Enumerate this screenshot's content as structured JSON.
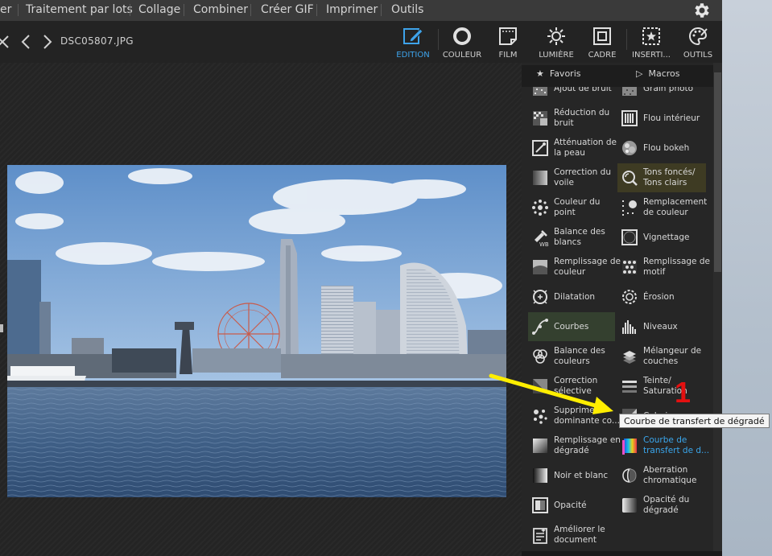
{
  "menu": {
    "items": [
      "er",
      "Traitement par lots",
      "Collage",
      "Combiner",
      "Créer GIF",
      "Imprimer",
      "Outils"
    ]
  },
  "toolbar": {
    "filename": "DSC05807.JPG",
    "tools": [
      {
        "label": "EDITION",
        "icon": "edit-icon",
        "active": true
      },
      {
        "label": "COULEUR",
        "icon": "color-ring-icon"
      },
      {
        "label": "FILM",
        "icon": "film-icon"
      },
      {
        "label": "LUMIÈRE",
        "icon": "sun-icon"
      },
      {
        "label": "CADRE",
        "icon": "frame-icon"
      },
      {
        "label": "INSERTI...",
        "icon": "insert-star-icon"
      },
      {
        "label": "OUTILS",
        "icon": "palette-tools-icon"
      }
    ]
  },
  "panel": {
    "favorites_label": "Favoris",
    "macros_label": "Macros",
    "effects": [
      {
        "label": "Ajout de bruit",
        "icon": "noise-add-icon"
      },
      {
        "label": "Grain photo",
        "icon": "grain-icon"
      },
      {
        "label": "Réduction du\nbruit",
        "icon": "noise-reduce-icon"
      },
      {
        "label": "Flou intérieur",
        "icon": "inner-blur-icon"
      },
      {
        "label": "Atténuation de\nla peau",
        "icon": "skin-soften-icon"
      },
      {
        "label": "Flou bokeh",
        "icon": "bokeh-icon"
      },
      {
        "label": "Correction du\nvoile",
        "icon": "dehaze-icon"
      },
      {
        "label": "Tons foncés/\nTons clairs",
        "icon": "shadows-highlights-icon"
      },
      {
        "label": "Couleur du\npoint",
        "icon": "color-point-icon"
      },
      {
        "label": "Remplacement\nde couleur",
        "icon": "color-replace-icon"
      },
      {
        "label": "Balance des\nblancs",
        "icon": "white-balance-icon"
      },
      {
        "label": "Vignettage",
        "icon": "vignette-icon"
      },
      {
        "label": "Remplissage de\ncouleur",
        "icon": "color-fill-icon"
      },
      {
        "label": "Remplissage de\nmotif",
        "icon": "pattern-fill-icon"
      },
      {
        "label": "Dilatation",
        "icon": "dilate-icon"
      },
      {
        "label": "Érosion",
        "icon": "erode-icon"
      },
      {
        "label": "Courbes",
        "icon": "curves-icon"
      },
      {
        "label": "Niveaux",
        "icon": "levels-icon"
      },
      {
        "label": "Balance des\ncouleurs",
        "icon": "color-balance-icon"
      },
      {
        "label": "Mélangeur de\ncouches",
        "icon": "channel-mixer-icon"
      },
      {
        "label": "Correction\nsélective",
        "icon": "selective-correction-icon"
      },
      {
        "label": "Teinte/\nSaturation",
        "icon": "hue-saturation-icon"
      },
      {
        "label": "Supprimer\ndominante co...",
        "icon": "remove-cast-icon"
      },
      {
        "label": "Coloriser",
        "icon": "colorize-icon"
      },
      {
        "label": "Remplissage en\ndégradé",
        "icon": "gradient-fill-icon"
      },
      {
        "label": "Courbe de\ntransfert de d...",
        "icon": "gradient-map-icon"
      },
      {
        "label": "Noir et blanc",
        "icon": "black-white-icon"
      },
      {
        "label": "Aberration\nchromatique",
        "icon": "chromatic-aberration-icon"
      },
      {
        "label": "Opacité",
        "icon": "opacity-icon"
      },
      {
        "label": "Opacité du\ndégradé",
        "icon": "gradient-opacity-icon"
      },
      {
        "label": "Améliorer le\ndocument",
        "icon": "document-enhance-icon"
      }
    ]
  },
  "tooltip": "Courbe de transfert de dégradé",
  "annotation": {
    "step_number": "1",
    "arrow_color": "#ffee00",
    "number_color": "#e31010"
  },
  "colors": {
    "accent": "#3aa6ec",
    "background": "#1e1e1e"
  }
}
